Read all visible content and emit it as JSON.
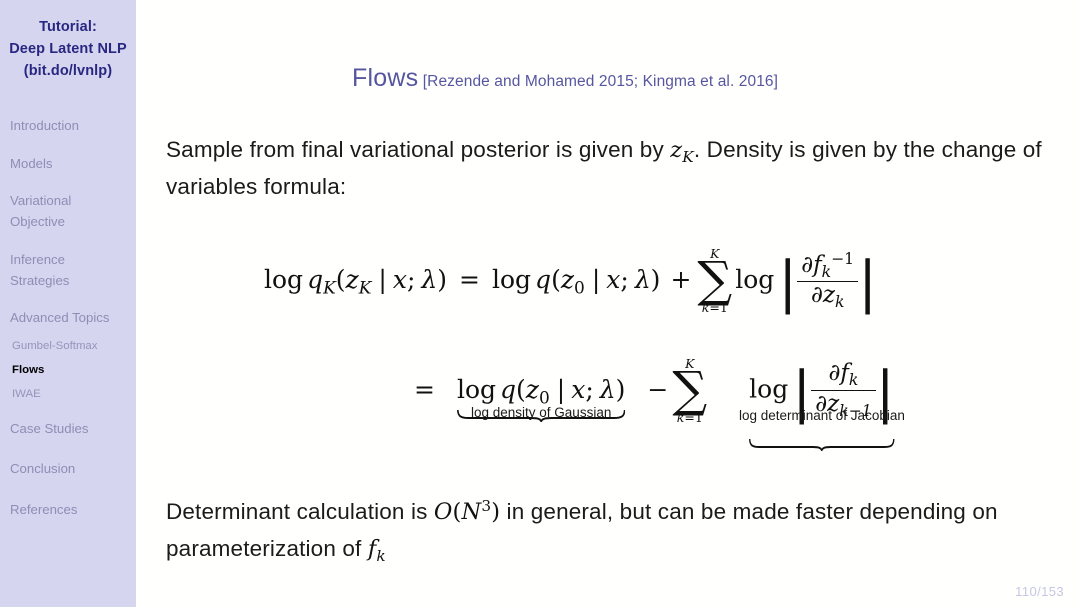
{
  "sidebar": {
    "title_lines": [
      "Tutorial:",
      "Deep Latent NLP",
      "(bit.do/lvnlp)"
    ],
    "sections": [
      {
        "label": "Introduction",
        "current": false
      },
      {
        "label": "Models",
        "current": false
      },
      {
        "label": "Variational Objective",
        "current": false
      },
      {
        "label": "Inference Strategies",
        "current": false
      },
      {
        "label": "Advanced Topics",
        "current": false
      },
      {
        "label": "Case Studies",
        "current": false
      },
      {
        "label": "Conclusion",
        "current": false
      },
      {
        "label": "References",
        "current": false
      }
    ],
    "subsections": [
      {
        "label": "Gumbel-Softmax",
        "current": false
      },
      {
        "label": "Flows",
        "current": true
      },
      {
        "label": "IWAE",
        "current": false
      }
    ],
    "colors": {
      "background": "#d5d5f0",
      "title": "#292780",
      "item": "#8e8eb4",
      "current_item": "#000000"
    }
  },
  "main": {
    "title": "Flows",
    "title_citation": "[Rezende and Mohamed 2015; Kingma et al. 2016]",
    "title_color": "#5656a0",
    "paragraph_top": "Sample from final variational posterior is given by zK. Density is given by the change of variables formula:",
    "paragraph_top_parts": {
      "a": "Sample from final variational posterior is given by ",
      "var": "z",
      "var_sub": "K",
      "b": ". Density is given by the change of variables formula:"
    },
    "paragraph_bottom_parts": {
      "a": "Determinant calculation is ",
      "bigo": "O",
      "bigo_arg": "N",
      "bigo_exp": "3",
      "b": " in general, but can be made faster depending on parameterization of ",
      "fvar": "f",
      "fvar_sub": "k"
    },
    "equation": {
      "line1": {
        "lhs": "log qK(zK | x; λ)",
        "rel": "=",
        "rhs": "log q(z0 | x; λ) + sum_{k=1}^{K} log |∂f_k^{-1} / ∂z_k|",
        "sum_upper": "K",
        "sum_lower_index": "k",
        "sum_lower_value": "1",
        "frac_num": "∂f",
        "frac_num_sub": "k",
        "frac_num_sup": "−1",
        "frac_den": "∂z",
        "frac_den_sub": "k"
      },
      "line2": {
        "rel": "=",
        "term1": "log q(z0 | x; λ)",
        "term1_label": "log density of Gaussian",
        "minus": "−",
        "sum_upper": "K",
        "sum_lower_index": "k",
        "sum_lower_value": "1",
        "term2": "log |∂f_k / ∂z_{k−1}|",
        "term2_label": "log determinant of Jacobian",
        "frac_num": "∂f",
        "frac_num_sub": "k",
        "frac_den": "∂z",
        "frac_den_sub": "k−1"
      },
      "tokens": {
        "log": "log",
        "q": "q",
        "z": "z",
        "x": "x",
        "lambda": "λ",
        "mid": "|",
        "semi": ";",
        "K": "K",
        "k": "k",
        "zero": "0",
        "one": "1",
        "eq": "=",
        "plus": "+",
        "minus": "−",
        "sigma": "∑",
        "bar": "|",
        "lparen": "(",
        "rparen": ")"
      }
    }
  },
  "footer": {
    "page": "110/153",
    "color": "#c6c6e2"
  }
}
